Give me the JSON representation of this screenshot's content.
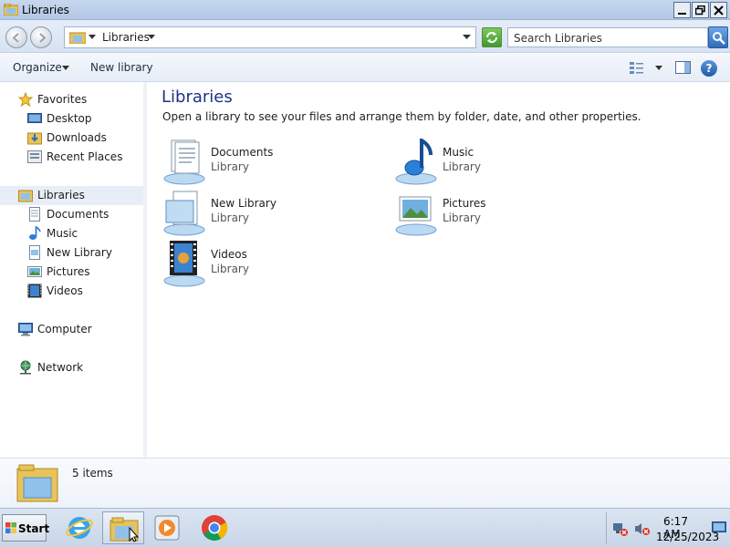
{
  "window": {
    "title": "Libraries"
  },
  "address": {
    "path": "Libraries",
    "search_placeholder": "Search Libraries"
  },
  "toolbar": {
    "organize": "Organize",
    "new_library": "New library"
  },
  "sidebar": {
    "favorites": {
      "label": "Favorites",
      "icon": "star-icon",
      "items": [
        {
          "label": "Desktop",
          "icon": "desktop-icon"
        },
        {
          "label": "Downloads",
          "icon": "downloads-icon"
        },
        {
          "label": "Recent Places",
          "icon": "recent-places-icon"
        }
      ]
    },
    "libraries": {
      "label": "Libraries",
      "icon": "libraries-icon",
      "items": [
        {
          "label": "Documents",
          "icon": "documents-icon"
        },
        {
          "label": "Music",
          "icon": "music-icon"
        },
        {
          "label": "New Library",
          "icon": "new-library-icon"
        },
        {
          "label": "Pictures",
          "icon": "pictures-icon"
        },
        {
          "label": "Videos",
          "icon": "videos-icon"
        }
      ]
    },
    "computer": {
      "label": "Computer",
      "icon": "computer-icon"
    },
    "network": {
      "label": "Network",
      "icon": "network-icon"
    }
  },
  "main": {
    "title": "Libraries",
    "subtitle": "Open a library to see your files and arrange them by folder, date, and other properties.",
    "libraries": [
      {
        "name": "Documents",
        "type": "Library",
        "icon": "documents-library-icon"
      },
      {
        "name": "Music",
        "type": "Library",
        "icon": "music-library-icon"
      },
      {
        "name": "New Library",
        "type": "Library",
        "icon": "new-library-icon"
      },
      {
        "name": "Pictures",
        "type": "Library",
        "icon": "pictures-library-icon"
      },
      {
        "name": "Videos",
        "type": "Library",
        "icon": "videos-library-icon"
      }
    ]
  },
  "details": {
    "count": "5 items"
  },
  "taskbar": {
    "start_label": "Start",
    "time": "6:17 AM",
    "date": "12/25/2023",
    "pinned": [
      "internet-explorer-icon",
      "windows-explorer-icon",
      "media-player-icon",
      "chrome-icon"
    ]
  },
  "colors": {
    "title_blue": "#1e3287",
    "selection": "#e8eef7",
    "accent": "#2f6dbb"
  }
}
